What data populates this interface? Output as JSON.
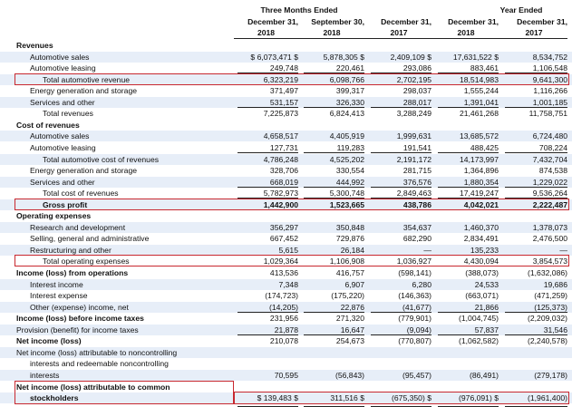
{
  "headers": {
    "three_months_ended": "Three Months Ended",
    "year_ended": "Year Ended",
    "cols": [
      {
        "date": "December 31,",
        "year": "2018"
      },
      {
        "date": "September 30,",
        "year": "2018"
      },
      {
        "date": "December 31,",
        "year": "2017"
      },
      {
        "date": "December 31,",
        "year": "2018"
      },
      {
        "date": "December 31,",
        "year": "2017"
      }
    ]
  },
  "rows": [
    {
      "label": "Revenues",
      "values": [
        "",
        "",
        "",
        "",
        ""
      ]
    },
    {
      "label": "Automotive sales",
      "values": [
        "$        6,073,471 $",
        "5,878,305 $",
        "2,409,109 $",
        "17,631,522 $",
        "8,534,752"
      ]
    },
    {
      "label": "Automotive leasing",
      "values": [
        "249,748",
        "220,461",
        "293,086",
        "883,461",
        "1,106,548"
      ]
    },
    {
      "label": "Total automotive revenue",
      "values": [
        "6,323,219",
        "6,098,766",
        "2,702,195",
        "18,514,983",
        "9,641,300"
      ]
    },
    {
      "label": "Energy generation and storage",
      "values": [
        "371,497",
        "399,317",
        "298,037",
        "1,555,244",
        "1,116,266"
      ]
    },
    {
      "label": "Services and other",
      "values": [
        "531,157",
        "326,330",
        "288,017",
        "1,391,041",
        "1,001,185"
      ]
    },
    {
      "label": "Total revenues",
      "values": [
        "7,225,873",
        "6,824,413",
        "3,288,249",
        "21,461,268",
        "11,758,751"
      ]
    },
    {
      "label": "Cost of revenues",
      "values": [
        "",
        "",
        "",
        "",
        ""
      ]
    },
    {
      "label": "Automotive sales",
      "values": [
        "4,658,517",
        "4,405,919",
        "1,999,631",
        "13,685,572",
        "6,724,480"
      ]
    },
    {
      "label": "Automotive leasing",
      "values": [
        "127,731",
        "119,283",
        "191,541",
        "488,425",
        "708,224"
      ]
    },
    {
      "label": "Total automotive cost of revenues",
      "values": [
        "4,786,248",
        "4,525,202",
        "2,191,172",
        "14,173,997",
        "7,432,704"
      ]
    },
    {
      "label": "Energy generation and storage",
      "values": [
        "328,706",
        "330,554",
        "281,715",
        "1,364,896",
        "874,538"
      ]
    },
    {
      "label": "Services and other",
      "values": [
        "668,019",
        "444,992",
        "376,576",
        "1,880,354",
        "1,229,022"
      ]
    },
    {
      "label": "Total cost of revenues",
      "values": [
        "5,782,973",
        "5,300,748",
        "2,849,463",
        "17,419,247",
        "9,536,264"
      ]
    },
    {
      "label": "Gross profit",
      "values": [
        "1,442,900",
        "1,523,665",
        "438,786",
        "4,042,021",
        "2,222,487"
      ]
    },
    {
      "label": "Operating expenses",
      "values": [
        "",
        "",
        "",
        "",
        ""
      ]
    },
    {
      "label": "Research and development",
      "values": [
        "356,297",
        "350,848",
        "354,637",
        "1,460,370",
        "1,378,073"
      ]
    },
    {
      "label": "Selling, general and administrative",
      "values": [
        "667,452",
        "729,876",
        "682,290",
        "2,834,491",
        "2,476,500"
      ]
    },
    {
      "label": "Restructuring and other",
      "values": [
        "5,615",
        "26,184",
        "—",
        "135,233",
        "—"
      ]
    },
    {
      "label": "Total operating expenses",
      "values": [
        "1,029,364",
        "1,106,908",
        "1,036,927",
        "4,430,094",
        "3,854,573"
      ]
    },
    {
      "label": "Income (loss) from operations",
      "values": [
        "413,536",
        "416,757",
        "(598,141)",
        "(388,073)",
        "(1,632,086)"
      ]
    },
    {
      "label": "Interest income",
      "values": [
        "7,348",
        "6,907",
        "6,280",
        "24,533",
        "19,686"
      ]
    },
    {
      "label": "Interest expense",
      "values": [
        "(174,723)",
        "(175,220)",
        "(146,363)",
        "(663,071)",
        "(471,259)"
      ]
    },
    {
      "label": "Other (expense) income, net",
      "values": [
        "(14,205)",
        "22,876",
        "(41,677)",
        "21,866",
        "(125,373)"
      ]
    },
    {
      "label": "Income (loss) before income taxes",
      "values": [
        "231,956",
        "271,320",
        "(779,901)",
        "(1,004,745)",
        "(2,209,032)"
      ]
    },
    {
      "label": "Provision (benefit) for income taxes",
      "values": [
        "21,878",
        "16,647",
        "(9,094)",
        "57,837",
        "31,546"
      ]
    },
    {
      "label": "Net income (loss)",
      "values": [
        "210,078",
        "254,673",
        "(770,807)",
        "(1,062,582)",
        "(2,240,578)"
      ]
    },
    {
      "label": "Net income (loss) attributable to noncontrolling",
      "values": [
        "",
        "",
        "",
        "",
        ""
      ]
    },
    {
      "label": "interests and redeemable noncontrolling",
      "values": [
        "",
        "",
        "",
        "",
        ""
      ]
    },
    {
      "label": "interests",
      "values": [
        "70,595",
        "(56,843)",
        "(95,457)",
        "(86,491)",
        "(279,178)"
      ]
    },
    {
      "label": "Net income (loss) attributable to common",
      "values": [
        "",
        "",
        "",
        "",
        ""
      ]
    },
    {
      "label": "stockholders",
      "values": [
        "$          139,483 $",
        "311,516 $",
        "(675,350) $",
        "(976,091) $",
        "(1,961,400)"
      ]
    }
  ]
}
